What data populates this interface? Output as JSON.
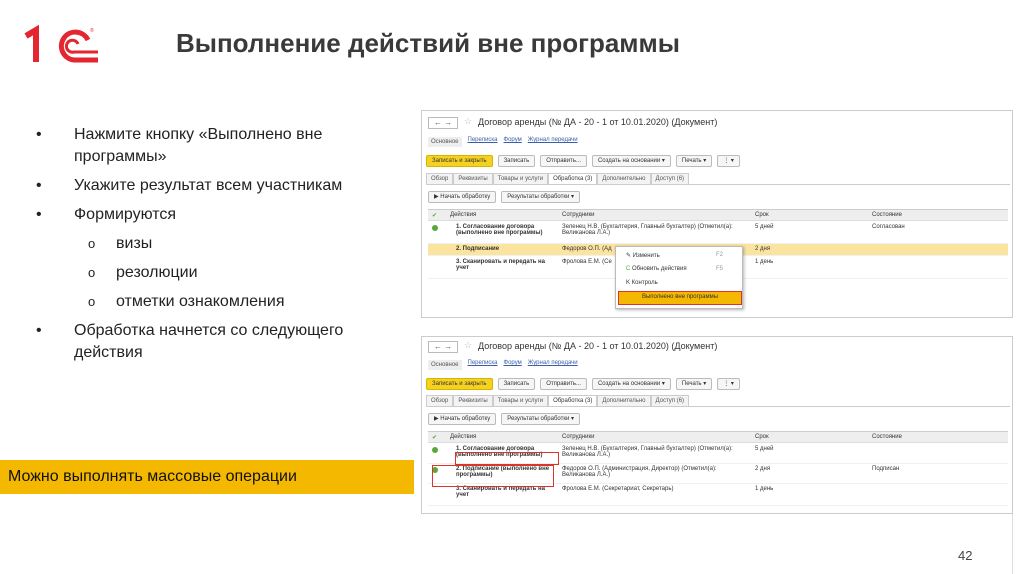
{
  "slide": {
    "logo_text": "1С",
    "title": "Выполнение действий вне программы",
    "bullets": [
      "Нажмите кнопку «Выполнено вне программы»",
      "Укажите результат всем участникам",
      "Формируются",
      "Обработка начнется со следующего действия"
    ],
    "sub_bullets": [
      "визы",
      "резолюции",
      "отметки ознакомления"
    ],
    "banner": "Можно выполнять массовые операции",
    "page_number": "42"
  },
  "doc": {
    "title": "Договор аренды (№ ДА - 20 - 1 от 10.01.2020) (Документ)",
    "nav_tabs": [
      "Основное",
      "Переписка",
      "Форум",
      "Журнал передачи"
    ],
    "toolbar": [
      "Записать и закрыть",
      "Записать",
      "Отправить...",
      "Создать на основании ▾",
      "Печать ▾",
      "⋮ ▾"
    ],
    "sub_tabs": [
      "Обзор",
      "Реквизиты",
      "Товары и услуги",
      "Обработка (3)",
      "Дополнительно",
      "Доступ (6)"
    ],
    "process_buttons": [
      "▶ Начать обработку",
      "Результаты обработки ▾"
    ],
    "columns": [
      "Действия",
      "Сотрудники",
      "Срок",
      "Состояние"
    ]
  },
  "shot1": {
    "rows": [
      {
        "action": "1. Согласование договора (выполнено вне программы)",
        "employee": "Зеленец Н.В. (Бухгалтерия, Главный бухгалтер) (Отметил(а): Великанова Л.А.)",
        "term": "5 дней",
        "state": "Согласован"
      },
      {
        "action": "2. Подписание",
        "employee": "Федоров О.П. (Ад",
        "term": "2 дня",
        "state": ""
      },
      {
        "action": "3. Сканировать и передать на учет",
        "employee": "Фролова Е.М. (Се",
        "term": "1 день",
        "state": ""
      }
    ],
    "context_menu": [
      {
        "label": "Изменить",
        "key": "F2"
      },
      {
        "label": "Обновить действия",
        "key": "F5"
      },
      {
        "label": "Контроль",
        "key": ""
      },
      {
        "label": "Выполнено вне программы",
        "key": ""
      }
    ]
  },
  "shot2": {
    "rows": [
      {
        "action": "1. Согласование договора (выполнено вне программы)",
        "employee": "Зеленец Н.В. (Бухгалтерия, Главный бухгалтер) (Отметил(а): Великанова Л.А.)",
        "term": "5 дней",
        "state": ""
      },
      {
        "action": "2. Подписание (выполнено вне программы)",
        "employee": "Федоров О.П. (Администрация, Директор) (Отметил(а): Великанова Л.А.)",
        "term": "2 дня",
        "state": "Подписан"
      },
      {
        "action": "3. Сканировать и передать на учет",
        "employee": "Фролова Е.М. (Секретариат, Секретарь)",
        "term": "1 день",
        "state": ""
      }
    ]
  },
  "colors": {
    "accent": "#f5b800",
    "brand_red": "#e3262f",
    "highlight_box": "#d9352a"
  }
}
